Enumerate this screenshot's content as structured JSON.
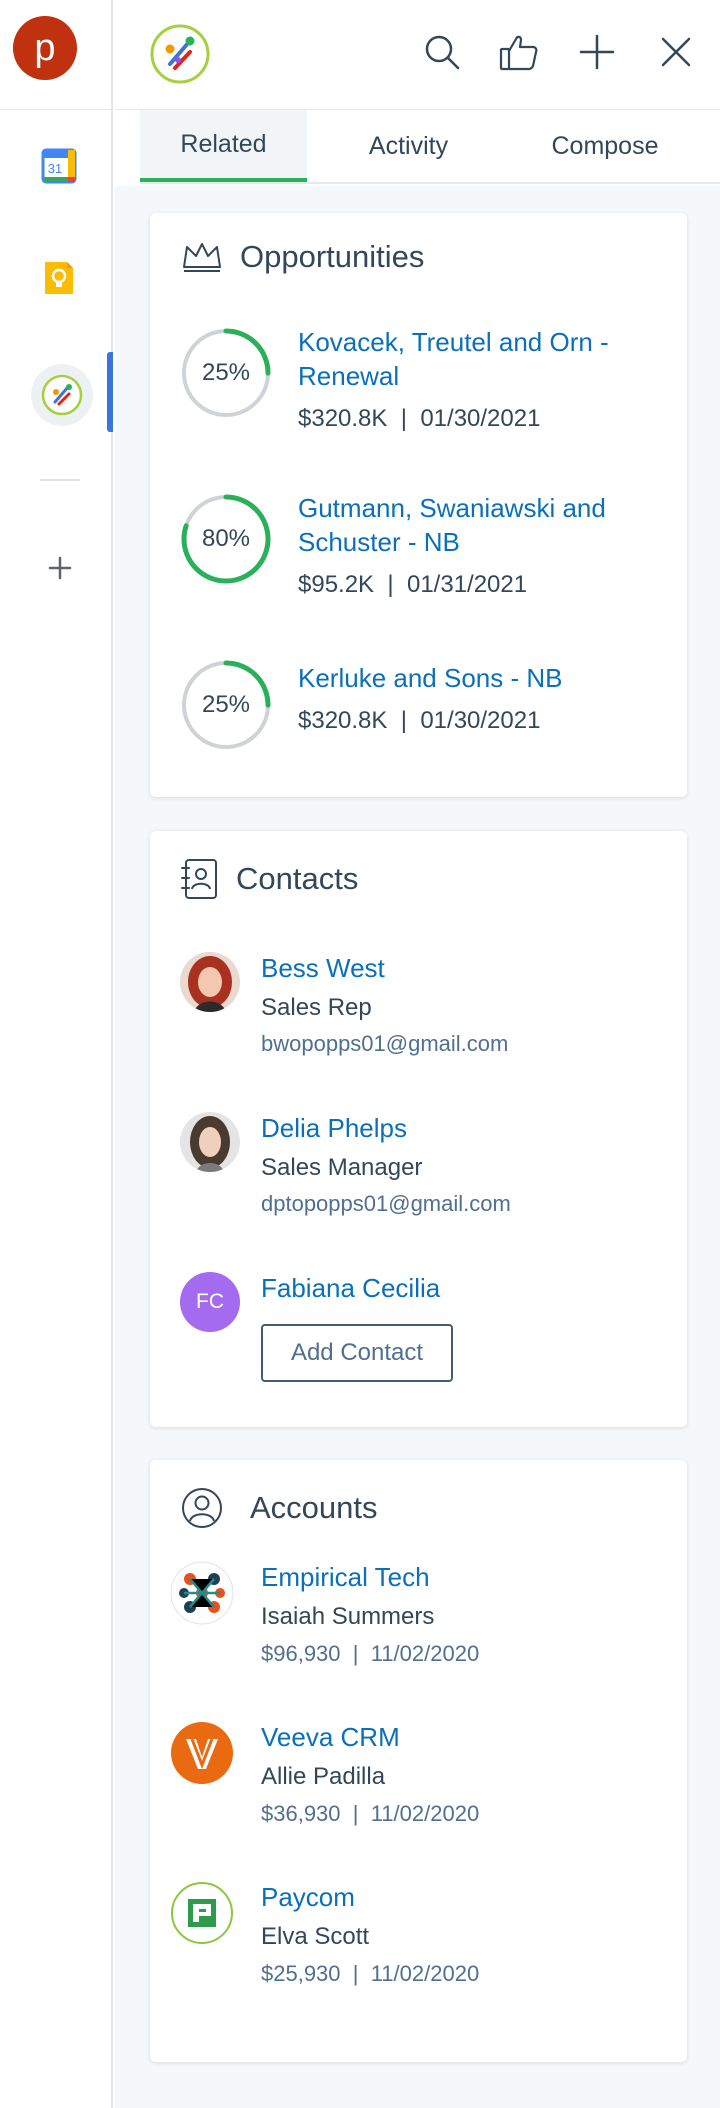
{
  "rail": {
    "avatar_letter": "p",
    "calendar_day": "31"
  },
  "tabs": [
    {
      "label": "Related",
      "active": true
    },
    {
      "label": "Activity",
      "active": false
    },
    {
      "label": "Compose",
      "active": false
    }
  ],
  "opportunities": {
    "title": "Opportunities",
    "items": [
      {
        "percent": "25%",
        "progress": 0.25,
        "name": "Kovacek, Treutel and Orn - Renewal",
        "amount": "$320.8K",
        "date": "01/30/2021"
      },
      {
        "percent": "80%",
        "progress": 0.8,
        "name": "Gutmann, Swaniawski and Schuster - NB",
        "amount": "$95.2K",
        "date": "01/31/2021"
      },
      {
        "percent": "25%",
        "progress": 0.25,
        "name": "Kerluke and Sons - NB",
        "amount": "$320.8K",
        "date": "01/30/2021"
      }
    ]
  },
  "contacts": {
    "title": "Contacts",
    "items": [
      {
        "name": "Bess West",
        "role": "Sales Rep",
        "email": "bwopopps01@gmail.com"
      },
      {
        "name": "Delia Phelps",
        "role": "Sales Manager",
        "email": "dptopopps01@gmail.com"
      },
      {
        "name": "Fabiana Cecilia",
        "initials": "FC"
      }
    ],
    "add_contact_label": "Add Contact"
  },
  "accounts": {
    "title": "Accounts",
    "items": [
      {
        "name": "Empirical Tech",
        "owner": "Isaiah Summers",
        "amount": "$96,930",
        "date": "11/02/2020"
      },
      {
        "name": "Veeva CRM",
        "owner": "Allie Padilla",
        "amount": "$36,930",
        "date": "11/02/2020"
      },
      {
        "name": "Paycom",
        "owner": "Elva Scott",
        "amount": "$25,930",
        "date": "11/02/2020"
      }
    ]
  },
  "colors": {
    "link": "#0b6fba",
    "progress": "#2bb05a",
    "track": "#cfd3d7",
    "accent_tab": "#2bb05a",
    "avatar_p": "#c0310f",
    "avatar_fc": "#a46bf0"
  }
}
